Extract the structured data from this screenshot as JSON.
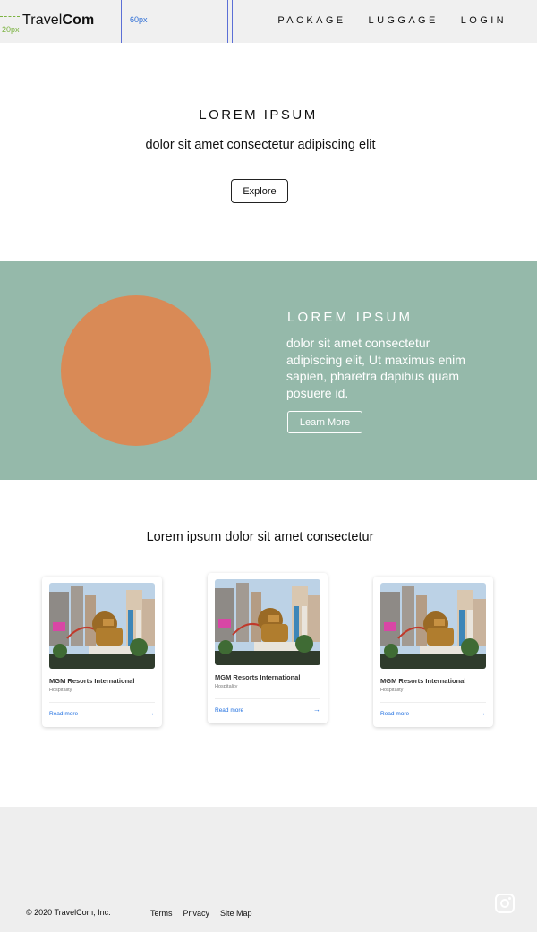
{
  "header": {
    "logo_light": "Travel",
    "logo_bold": "Com",
    "guide_left_label": "20px",
    "guide_right_label": "60px",
    "nav": [
      "PACKAGE",
      "LUGGAGE",
      "LOGIN"
    ]
  },
  "hero": {
    "title": "LOREM IPSUM",
    "subtitle": "dolor sit amet consectetur adipiscing elit",
    "button": "Explore"
  },
  "band": {
    "title": "LOREM IPSUM",
    "text": "dolor sit amet consectetur adipiscing elit, Ut maximus enim sapien, pharetra dapibus quam posuere id.",
    "button": "Learn More",
    "background": "#95b9aa",
    "circle_color": "#d98a56"
  },
  "cards_section": {
    "title": "Lorem ipsum dolor sit amet consectetur",
    "cards": [
      {
        "title": "MGM Resorts International",
        "category": "Hospitality",
        "link": "Read more",
        "image_icon": "lion-statue-photo",
        "arrow_icon": "arrow-right-icon"
      },
      {
        "title": "MGM Resorts International",
        "category": "Hospitality",
        "link": "Read more",
        "image_icon": "lion-statue-photo",
        "arrow_icon": "arrow-right-icon"
      },
      {
        "title": "MGM Resorts International",
        "category": "Hospitality",
        "link": "Read more",
        "image_icon": "lion-statue-photo",
        "arrow_icon": "arrow-right-icon"
      }
    ]
  },
  "footer": {
    "copyright": "© 2020 TravelCom, Inc.",
    "links": [
      "Terms",
      "Privacy",
      "Site Map"
    ],
    "social_icon": "instagram-icon"
  }
}
